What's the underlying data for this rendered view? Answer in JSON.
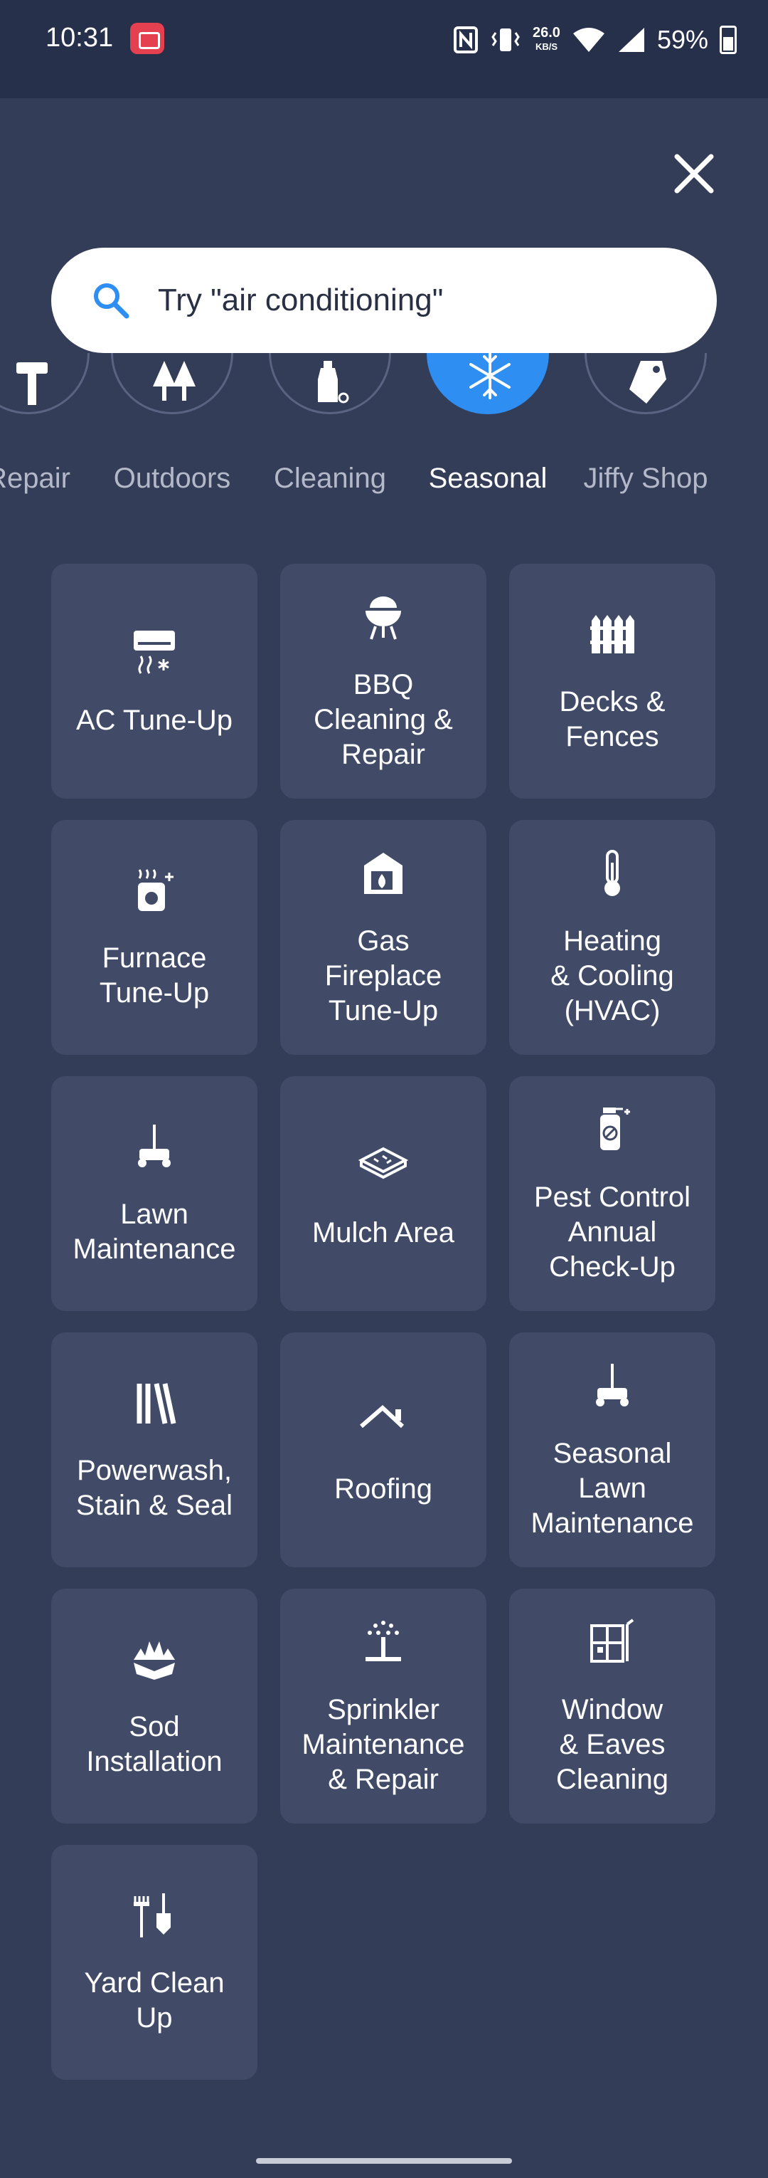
{
  "status_bar": {
    "time": "10:31",
    "net_speed_value": "26.0",
    "net_speed_unit": "KB/S",
    "battery_percent": "59%",
    "icons": [
      "screen-record-icon",
      "nfc-icon",
      "vibrate-icon",
      "wifi-icon",
      "signal-icon",
      "battery-icon"
    ]
  },
  "search": {
    "placeholder": "Try \"air conditioning\""
  },
  "categories": [
    {
      "label": "Repair",
      "icon": "hammer-icon",
      "active": false
    },
    {
      "label": "Outdoors",
      "icon": "trees-icon",
      "active": false
    },
    {
      "label": "Cleaning",
      "icon": "cleaning-bottle-icon",
      "active": false
    },
    {
      "label": "Seasonal",
      "icon": "snowflake-icon",
      "active": true
    },
    {
      "label": "Jiffy Shop",
      "icon": "tag-icon",
      "active": false
    }
  ],
  "services": [
    {
      "label": "AC Tune-Up",
      "icon": "ac-unit-icon"
    },
    {
      "label": "BBQ\nCleaning &\nRepair",
      "icon": "bbq-grill-icon"
    },
    {
      "label": "Decks &\nFences",
      "icon": "fence-icon"
    },
    {
      "label": "Furnace\nTune-Up",
      "icon": "furnace-icon"
    },
    {
      "label": "Gas\nFireplace\nTune-Up",
      "icon": "fireplace-icon"
    },
    {
      "label": "Heating\n& Cooling\n(HVAC)",
      "icon": "thermometer-icon"
    },
    {
      "label": "Lawn\nMaintenance",
      "icon": "lawn-mower-icon"
    },
    {
      "label": "Mulch Area",
      "icon": "mulch-icon"
    },
    {
      "label": "Pest Control\nAnnual\nCheck-Up",
      "icon": "pest-spray-icon"
    },
    {
      "label": "Powerwash,\nStain & Seal",
      "icon": "powerwash-icon"
    },
    {
      "label": "Roofing",
      "icon": "roof-icon"
    },
    {
      "label": "Seasonal\nLawn\nMaintenance",
      "icon": "lawn-mower-icon"
    },
    {
      "label": "Sod\nInstallation",
      "icon": "sod-icon"
    },
    {
      "label": "Sprinkler\nMaintenance\n& Repair",
      "icon": "sprinkler-icon"
    },
    {
      "label": "Window\n& Eaves\nCleaning",
      "icon": "window-cleaning-icon"
    },
    {
      "label": "Yard Clean\nUp",
      "icon": "rake-icon"
    }
  ]
}
